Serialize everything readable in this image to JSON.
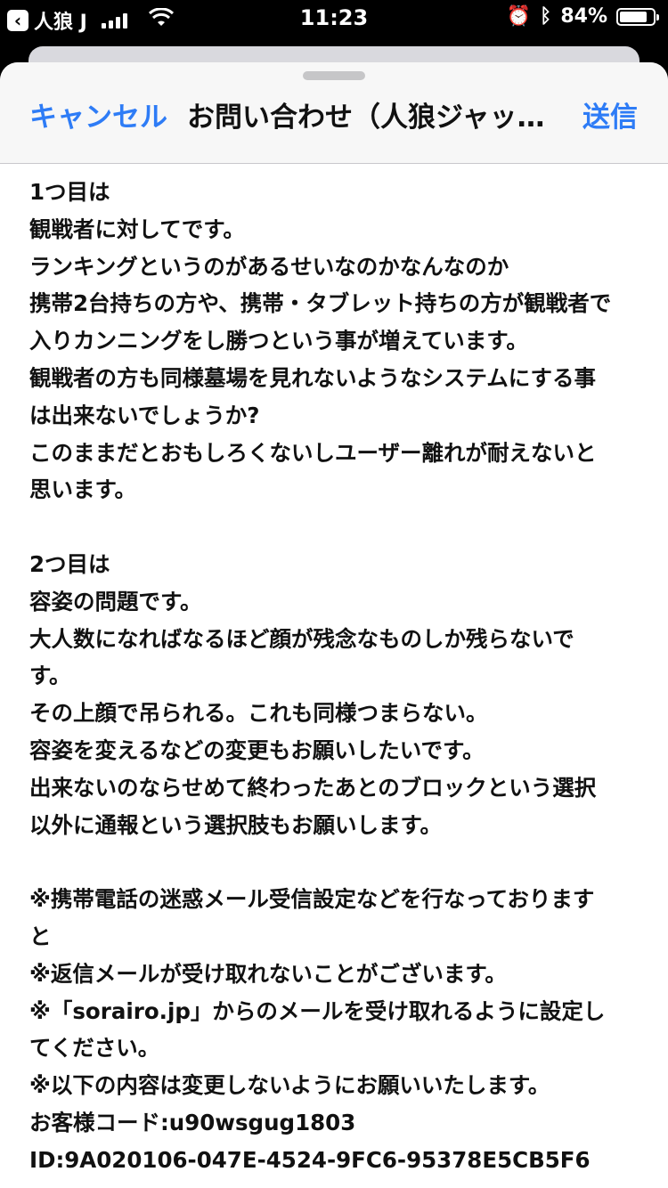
{
  "status_bar": {
    "back_app": "人狼 J",
    "time": "11:23",
    "battery_percent": "84%",
    "battery_level": 0.84,
    "icons": [
      "back-chevron-icon",
      "signal-icon",
      "wifi-icon",
      "alarm-icon",
      "bluetooth-icon",
      "battery-icon"
    ]
  },
  "header": {
    "cancel_label": "キャンセル",
    "title": "お問い合わせ（人狼ジャッ…",
    "send_label": "送信"
  },
  "message_lines": [
    "1つ目は",
    "観戦者に対してです。",
    "ランキングというのがあるせいなのかなんなのか",
    "携帯2台持ちの方や、携帯・タブレット持ちの方が観戦者で",
    "入りカンニングをし勝つという事が増えています。",
    "観戦者の方も同様墓場を見れないようなシステムにする事",
    "は出来ないでしょうか?",
    "このままだとおもしろくないしユーザー離れが耐えないと",
    "思います。",
    "",
    "2つ目は",
    "容姿の問題です。",
    "大人数になればなるほど顔が残念なものしか残らないで",
    "す。",
    "その上顔で吊られる。これも同様つまらない。",
    "容姿を変えるなどの変更もお願いしたいです。",
    "出来ないのならせめて終わったあとのブロックという選択",
    "以外に通報という選択肢もお願いします。",
    "",
    "※携帯電話の迷惑メール受信設定などを行なっております",
    "と",
    "※返信メールが受け取れないことがございます。",
    "※「sorairo.jp」からのメールを受け取れるように設定し",
    "てください。",
    "※以下の内容は変更しないようにお願いいたします。",
    "お客様コード:u90wsgug1803",
    "ID:9A020106-047E-4524-9FC6-95378E5CB5F6"
  ]
}
